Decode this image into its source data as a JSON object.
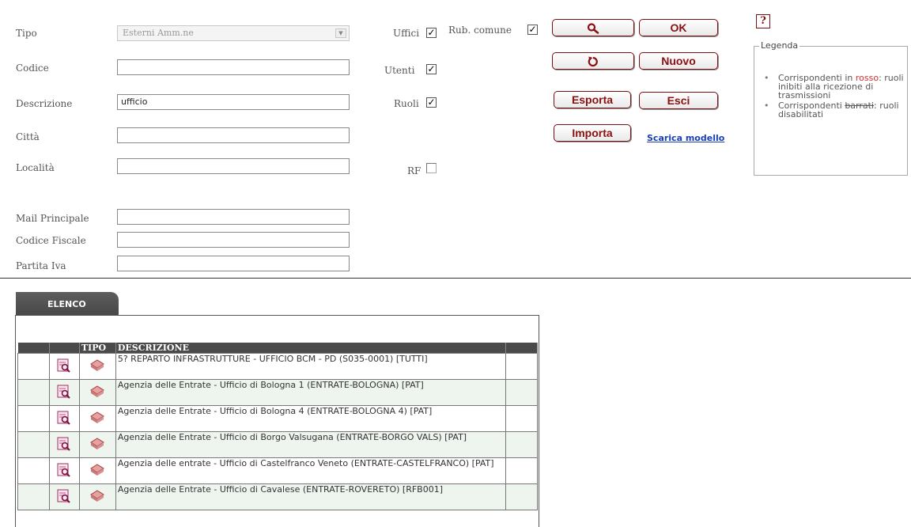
{
  "form": {
    "tipo_label": "Tipo",
    "tipo_value": "Esterni Amm.ne",
    "codice_label": "Codice",
    "codice_value": "",
    "descrizione_label": "Descrizione",
    "descrizione_value": "ufficio",
    "citta_label": "Città",
    "citta_value": "",
    "localita_label": "Località",
    "localita_value": "",
    "mail_label": "Mail Principale",
    "mail_value": "",
    "codice_fiscale_label": "Codice Fiscale",
    "codice_fiscale_value": "",
    "partita_iva_label": "Partita Iva",
    "partita_iva_value": ""
  },
  "checkboxes": {
    "uffici_label": "Uffici",
    "uffici_checked": true,
    "rub_comune_label": "Rub. comune",
    "rub_comune_checked": true,
    "utenti_label": "Utenti",
    "utenti_checked": true,
    "ruoli_label": "Ruoli",
    "ruoli_checked": true,
    "rf_label": "RF",
    "rf_checked": false,
    "check_mark": "✓"
  },
  "buttons": {
    "search_icon": "search-icon",
    "ok": "OK",
    "reset_icon": "refresh-icon",
    "nuovo": "Nuovo",
    "esporta": "Esporta",
    "esci": "Esci",
    "importa": "Importa",
    "scarica_modello": "Scarica modello"
  },
  "help": {
    "icon": "help-icon",
    "glyph": "⁈?"
  },
  "legend": {
    "title": "Legenda",
    "item1_prefix": "Corrispondenti in ",
    "item1_red": "rosso",
    "item1_suffix": ": ruoli inibiti alla ricezione di trasmissioni",
    "item2_prefix": "Corrispondenti ",
    "item2_strike": "barrati",
    "item2_suffix": ": ruoli disabilitati"
  },
  "list": {
    "tab_label": "ELENCO",
    "headers": {
      "c0": "",
      "c1": "",
      "tipo": "TIPO",
      "descrizione": "DESCRIZIONE",
      "c4": ""
    },
    "rows": [
      {
        "descrizione": "5? REPARTO INFRASTRUTTURE - UFFICIO BCM - PD (S035-0001) [TUTTI]"
      },
      {
        "descrizione": "Agenzia delle Entrate - Ufficio di Bologna 1 (ENTRATE-BOLOGNA) [PAT]"
      },
      {
        "descrizione": "Agenzia delle Entrate - Ufficio di Bologna 4 (ENTRATE-BOLOGNA 4) [PAT]"
      },
      {
        "descrizione": "Agenzia delle Entrate - Ufficio di Borgo Valsugana (ENTRATE-BORGO VALS) [PAT]"
      },
      {
        "descrizione": "Agenzia delle entrate - Ufficio di Castelfranco Veneto (ENTRATE-CASTELFRANCO) [PAT]"
      },
      {
        "descrizione": "Agenzia delle Entrate - Ufficio di Cavalese (ENTRATE-ROVERETO) [RFB001]"
      }
    ]
  },
  "colors": {
    "button_text": "#8b1010",
    "link": "#1a3fb5",
    "header_bg": "#4a4a4a",
    "alt_row": "#eef5ee"
  }
}
